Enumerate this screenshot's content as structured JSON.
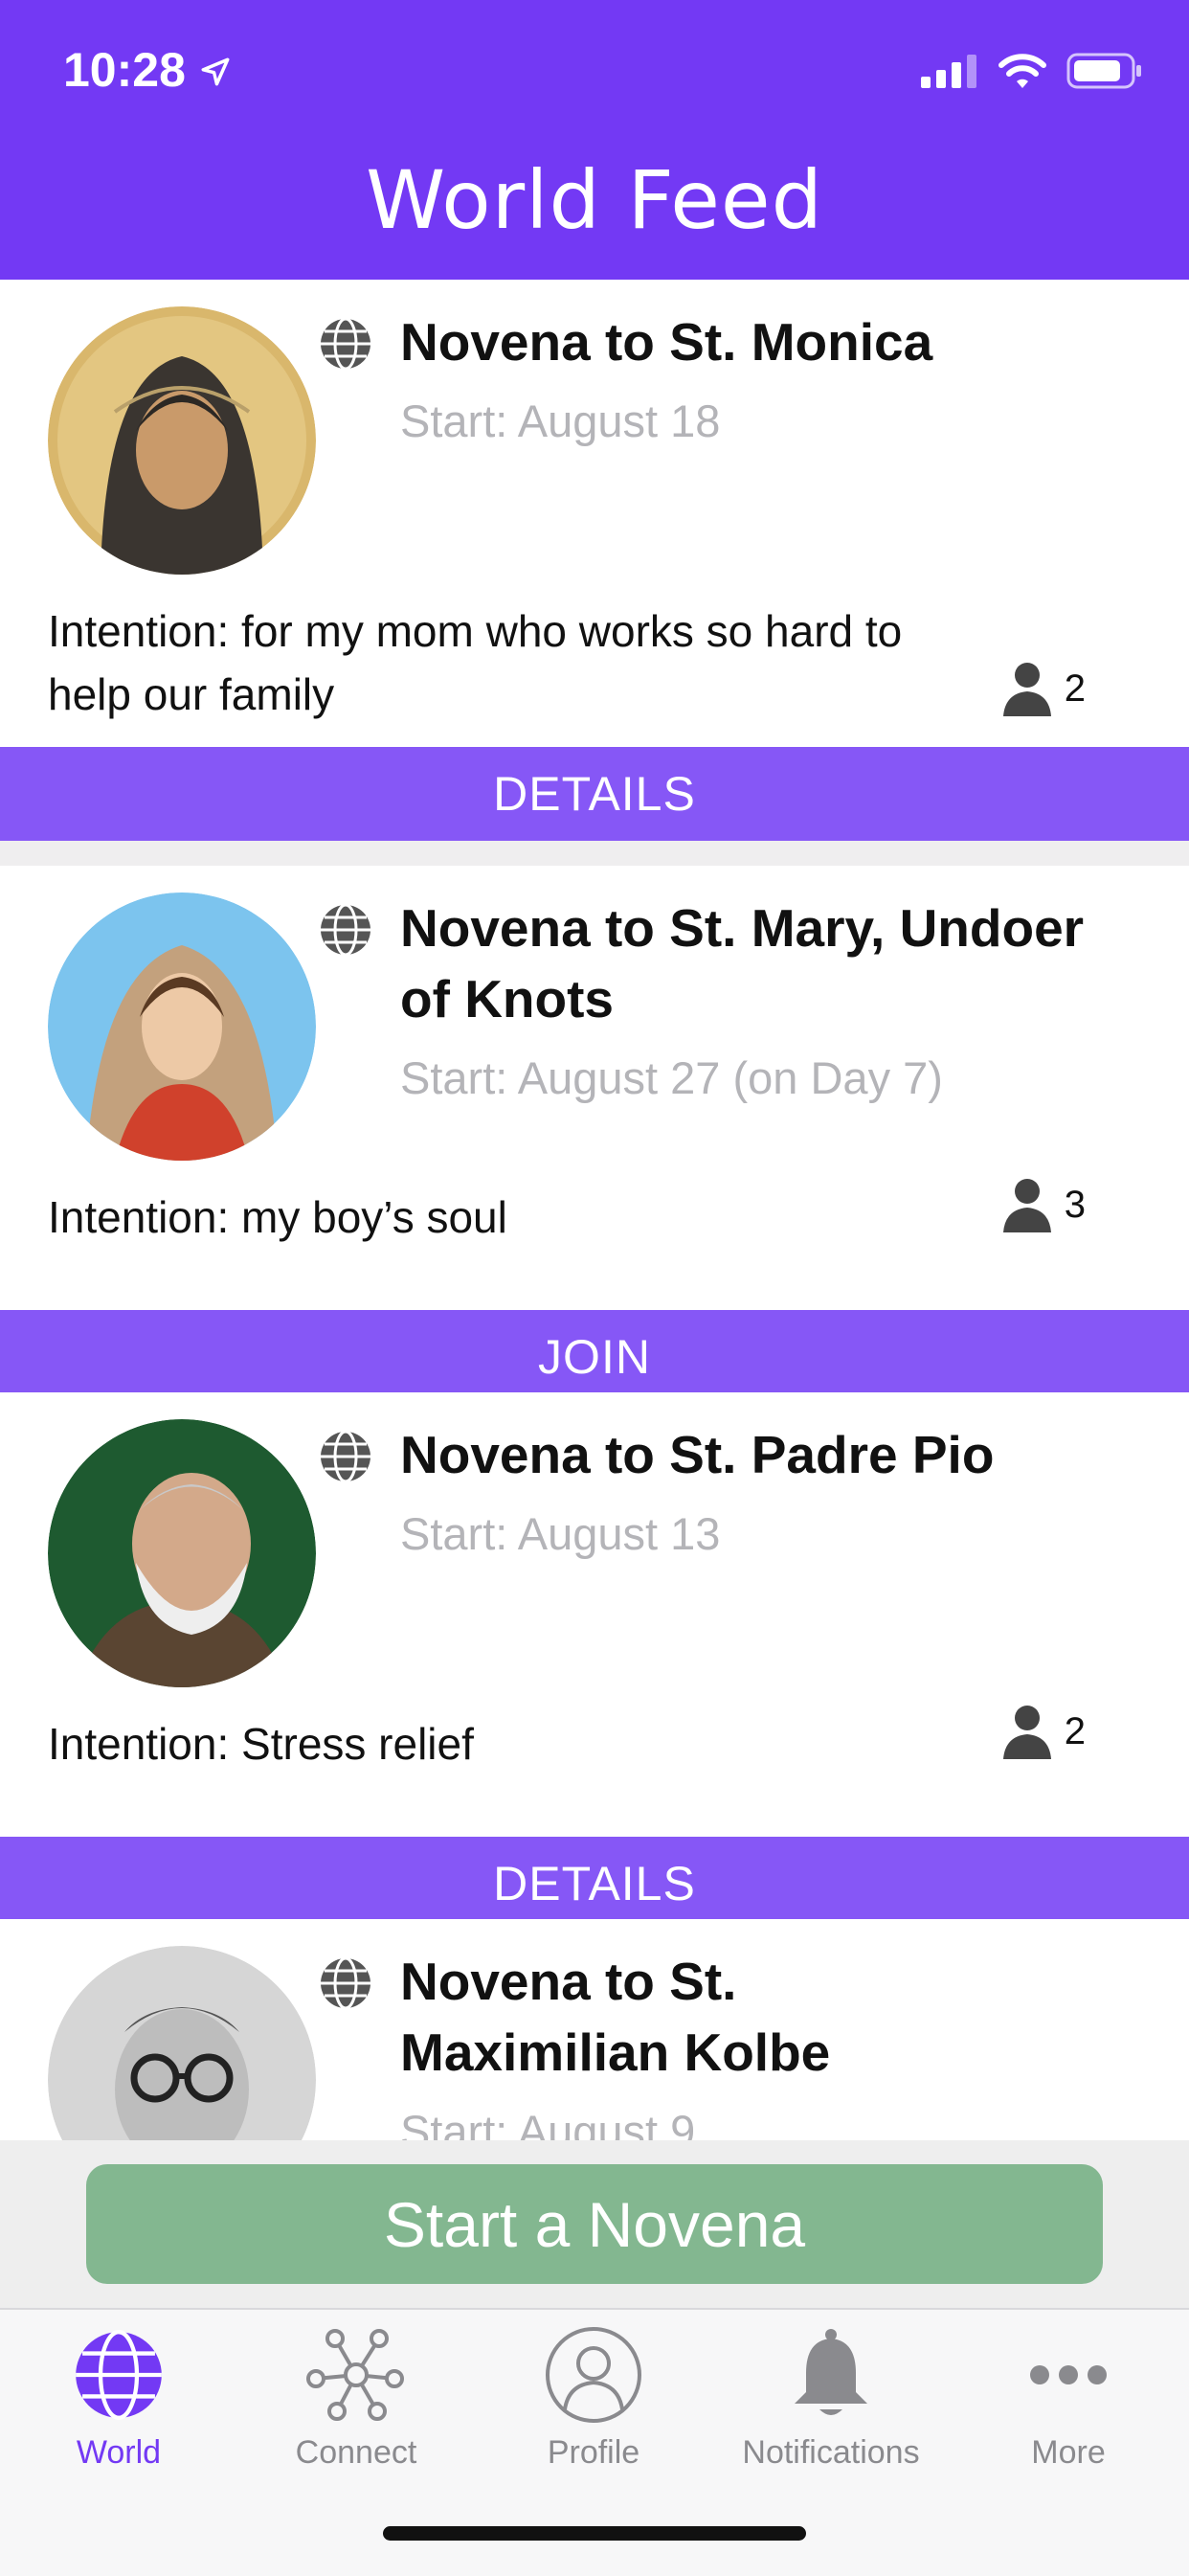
{
  "status_bar": {
    "time": "10:28"
  },
  "header": {
    "title": "World Feed"
  },
  "feed": [
    {
      "title": "Novena to St. Monica",
      "start": "Start: August 18",
      "intention": "Intention: for my mom who works so hard to help our family",
      "members": "2",
      "action": "DETAILS",
      "visibility_icon": "globe-icon",
      "saint_image": "st-monica-portrait"
    },
    {
      "title": "Novena to St. Mary, Undoer of Knots",
      "start": "Start: August 27 (on Day 7)",
      "intention": "Intention: my boy’s soul",
      "members": "3",
      "action": "JOIN",
      "visibility_icon": "globe-icon",
      "saint_image": "st-mary-portrait"
    },
    {
      "title": "Novena to St. Padre Pio",
      "start": "Start: August 13",
      "intention": "Intention: Stress relief",
      "members": "2",
      "action": "DETAILS",
      "visibility_icon": "globe-icon",
      "saint_image": "padre-pio-portrait"
    },
    {
      "title": "Novena to St. Maximilian Kolbe",
      "start": "Start: August 9",
      "visibility_icon": "globe-icon",
      "saint_image": "maximilian-kolbe-portrait"
    }
  ],
  "start_button": {
    "label": "Start a Novena"
  },
  "tabbar": {
    "tabs": [
      {
        "label": "World",
        "icon": "globe-icon"
      },
      {
        "label": "Connect",
        "icon": "network-icon"
      },
      {
        "label": "Profile",
        "icon": "profile-icon"
      },
      {
        "label": "Notifications",
        "icon": "bell-icon"
      },
      {
        "label": "More",
        "icon": "more-icon"
      }
    ]
  },
  "colors": {
    "brand": "#7339f4",
    "action_button": "#8657f6",
    "start_button": "#83b790",
    "muted_text": "#b4b4b8"
  }
}
